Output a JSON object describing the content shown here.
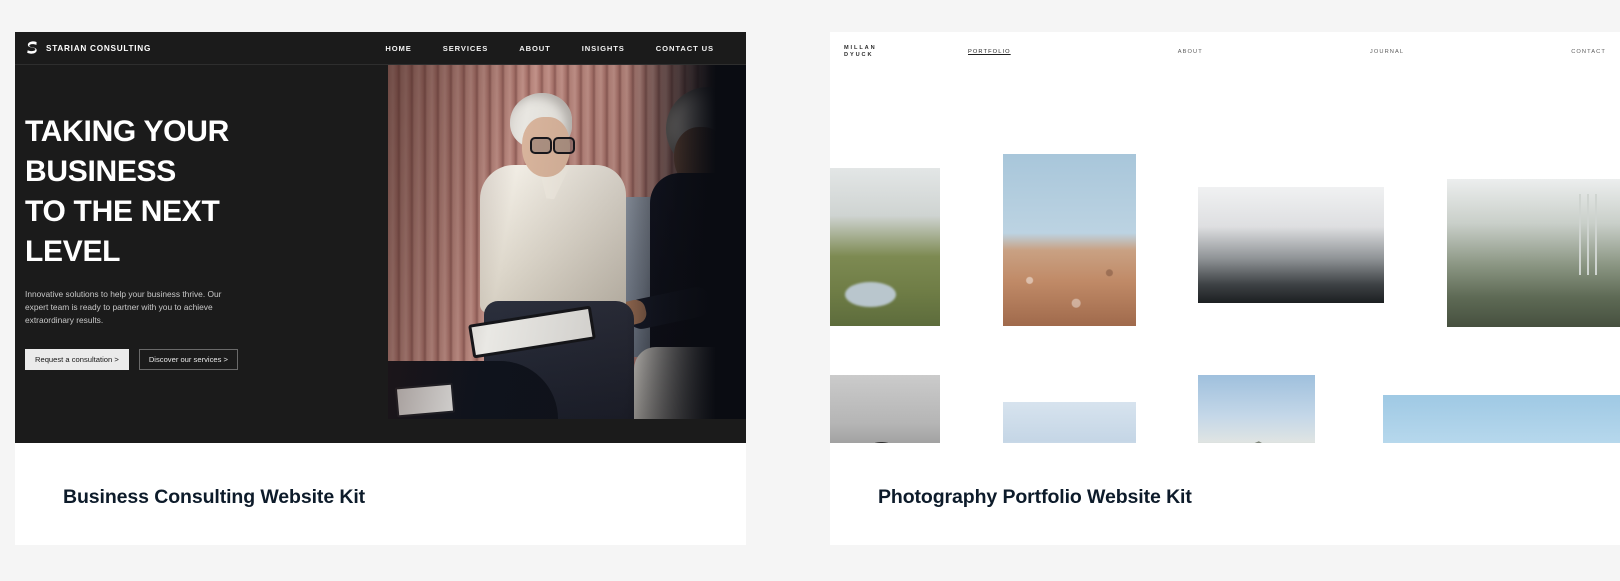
{
  "page": {
    "background_color": "#f5f5f5"
  },
  "cards": [
    {
      "caption": "Business Consulting Website Kit",
      "preview": {
        "theme_color": "#1b1b1b",
        "brand": {
          "name": "STARIAN CONSULTING",
          "logo_icon": "s-monogram-icon"
        },
        "nav": [
          {
            "label": "HOME"
          },
          {
            "label": "SERVICES"
          },
          {
            "label": "ABOUT"
          },
          {
            "label": "INSIGHTS"
          },
          {
            "label": "CONTACT US"
          }
        ],
        "hero": {
          "title_lines": [
            "TAKING YOUR",
            "BUSINESS",
            "TO THE NEXT",
            "LEVEL"
          ],
          "subtitle": "Innovative solutions to help your business thrive. Our expert team is ready to partner with you to achieve extraordinary results.",
          "buttons": [
            {
              "label": "Request a consultation >",
              "style": "primary"
            },
            {
              "label": "Discover our services >",
              "style": "ghost"
            }
          ],
          "photo_alt": "Two women in conversation seated against a terracotta slat wall"
        }
      }
    },
    {
      "caption": "Photography Portfolio Website Kit",
      "preview": {
        "theme_color": "#ffffff",
        "brand": {
          "line1": "MILLAN",
          "line2": "DYUCK"
        },
        "nav": [
          {
            "label": "PORTFOLIO",
            "active": true
          },
          {
            "label": "ABOUT",
            "active": false
          },
          {
            "label": "JOURNAL",
            "active": false
          },
          {
            "label": "CONTACT",
            "active": false
          }
        ],
        "gallery": [
          {
            "alt": "Green rolling hills with small pond"
          },
          {
            "alt": "Desert dunes under pale blue sky"
          },
          {
            "alt": "Black and white misty mountain ridge"
          },
          {
            "alt": "Forest clearing with metal tower"
          },
          {
            "alt": "Black and white rock in still water"
          },
          {
            "alt": "Snow covered mountain peaks"
          },
          {
            "alt": "Mountain summit under cloudy sky"
          },
          {
            "alt": "Calm blue sea and horizon"
          }
        ]
      }
    }
  ]
}
